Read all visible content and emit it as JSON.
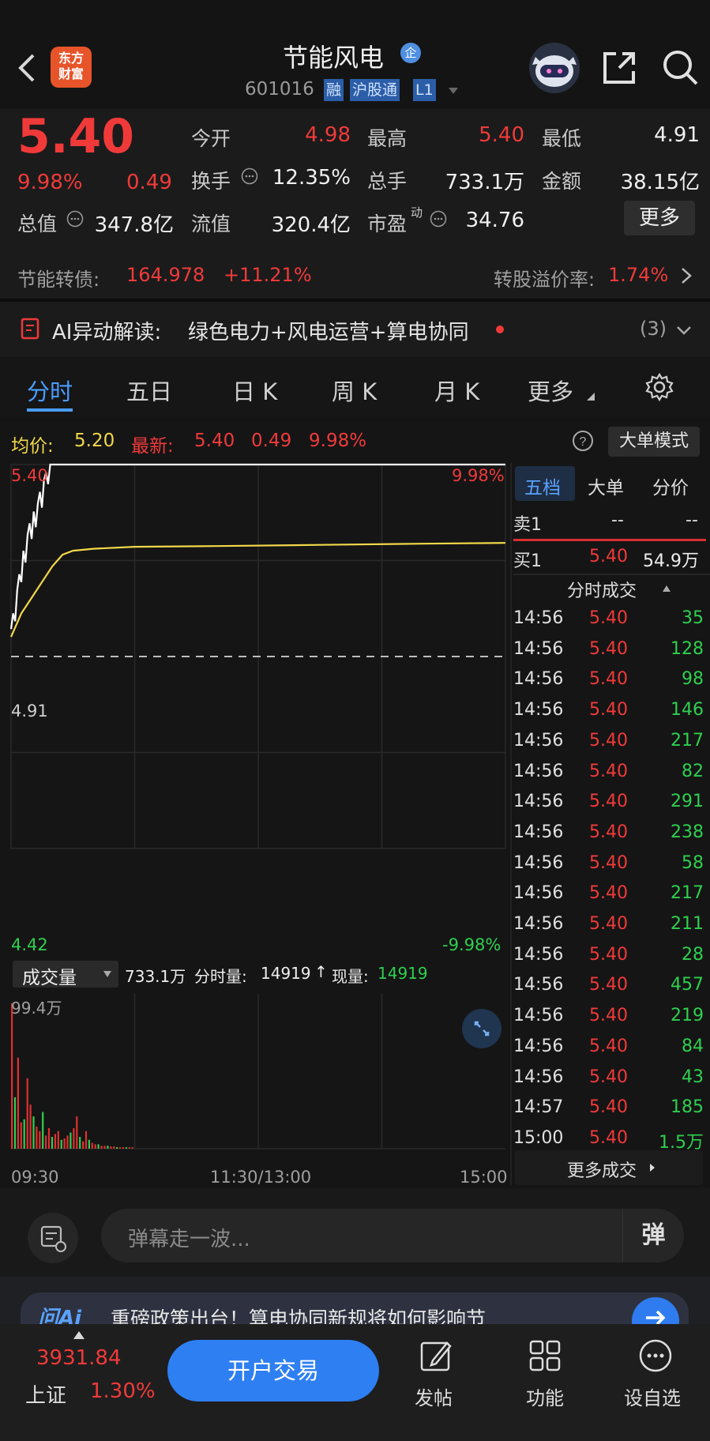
{
  "header": {
    "back_icon": "chevron-left-icon",
    "logo_line1": "东方",
    "logo_line2": "财富",
    "stock_name": "节能风电",
    "enterprise_badge": "企",
    "stock_code": "601016",
    "tags": [
      "融",
      "沪股通",
      "L1"
    ],
    "assistant_icon": "robot-avatar-icon",
    "share_icon": "share-icon",
    "search_icon": "search-icon"
  },
  "quote": {
    "price": "5.40",
    "change_pct": "9.98%",
    "change": "0.49",
    "today_open_label": "今开",
    "today_open": "4.98",
    "high_label": "最高",
    "high": "5.40",
    "low_label": "最低",
    "low": "4.91",
    "turnover_label": "换手",
    "turnover": "12.35%",
    "volume_label": "总手",
    "volume": "733.1万",
    "amount_label": "金额",
    "amount": "38.15亿",
    "mktcap_label": "总值",
    "mktcap": "347.8亿",
    "float_label": "流值",
    "float_cap": "320.4亿",
    "pe_label": "市盈",
    "pe_sup": "动",
    "pe": "34.76",
    "more_button": "更多"
  },
  "convertible": {
    "label": "节能转债:",
    "price": "164.978",
    "change": "+11.21%",
    "premium_label": "转股溢价率:",
    "premium": "1.74%"
  },
  "ai_bar": {
    "label": "AI异动解读:",
    "text": "绿色电力+风电运营+算电协同",
    "count": "(3)"
  },
  "tabs": [
    "分时",
    "五日",
    "日 K",
    "周 K",
    "月 K",
    "更多"
  ],
  "chart_info": {
    "avg_label": "均价:",
    "avg": "5.20",
    "latest_label": "最新:",
    "latest": "5.40",
    "latest_change": "0.49",
    "latest_pct": "9.98%",
    "big_order_mode": "大单模式"
  },
  "chart_data": {
    "type": "line",
    "x_ticks": [
      "09:30",
      "11:30/13:00",
      "15:00"
    ],
    "y_left_ticks": [
      "5.40",
      "4.91",
      "4.42"
    ],
    "y_right_ticks": [
      "9.98%",
      "-9.98%"
    ],
    "ylim": [
      4.42,
      5.4
    ],
    "prev_close": 4.91,
    "series": [
      {
        "name": "price",
        "color": "#ffffff",
        "x": [
          0,
          1,
          2,
          3,
          4,
          5,
          6,
          7,
          8,
          9,
          10,
          11,
          12,
          13,
          14,
          15,
          16,
          17,
          18,
          19,
          20,
          240
        ],
        "values": [
          4.98,
          5.02,
          5.0,
          5.08,
          5.12,
          5.1,
          5.18,
          5.15,
          5.22,
          5.25,
          5.21,
          5.28,
          5.24,
          5.3,
          5.33,
          5.29,
          5.36,
          5.38,
          5.35,
          5.4,
          5.4,
          5.4
        ]
      },
      {
        "name": "avg",
        "color": "#f2d84a",
        "x": [
          0,
          5,
          10,
          15,
          20,
          25,
          30,
          40,
          60,
          100,
          150,
          200,
          240
        ],
        "values": [
          4.96,
          5.02,
          5.06,
          5.1,
          5.14,
          5.17,
          5.18,
          5.185,
          5.19,
          5.192,
          5.195,
          5.198,
          5.2
        ]
      }
    ],
    "volume": {
      "label": "成交量",
      "total": "733.1万",
      "minute_label": "分时量:",
      "minute": "14919",
      "current_label": "现量:",
      "current": "14919",
      "max_tick": "99.4万",
      "bars": [
        99,
        35,
        62,
        18,
        20,
        48,
        30,
        22,
        15,
        12,
        25,
        9,
        14,
        8,
        10,
        12,
        6,
        7,
        9,
        11,
        14,
        22,
        8,
        5,
        12,
        6,
        4,
        3,
        3,
        2,
        2,
        2,
        1.5,
        1.5,
        1,
        1,
        1,
        1,
        1,
        1
      ]
    }
  },
  "orderbook": {
    "tabs": [
      "五档",
      "大单",
      "分价"
    ],
    "sell1_label": "卖1",
    "sell1_price": "--",
    "sell1_vol": "--",
    "buy1_label": "买1",
    "buy1_price": "5.40",
    "buy1_vol": "54.9万",
    "ticks_header": "分时成交",
    "ticks": [
      {
        "time": "14:56",
        "price": "5.40",
        "vol": "35"
      },
      {
        "time": "14:56",
        "price": "5.40",
        "vol": "128"
      },
      {
        "time": "14:56",
        "price": "5.40",
        "vol": "98"
      },
      {
        "time": "14:56",
        "price": "5.40",
        "vol": "146"
      },
      {
        "time": "14:56",
        "price": "5.40",
        "vol": "217"
      },
      {
        "time": "14:56",
        "price": "5.40",
        "vol": "82"
      },
      {
        "time": "14:56",
        "price": "5.40",
        "vol": "291"
      },
      {
        "time": "14:56",
        "price": "5.40",
        "vol": "238"
      },
      {
        "time": "14:56",
        "price": "5.40",
        "vol": "58"
      },
      {
        "time": "14:56",
        "price": "5.40",
        "vol": "217"
      },
      {
        "time": "14:56",
        "price": "5.40",
        "vol": "211"
      },
      {
        "time": "14:56",
        "price": "5.40",
        "vol": "28"
      },
      {
        "time": "14:56",
        "price": "5.40",
        "vol": "457"
      },
      {
        "time": "14:56",
        "price": "5.40",
        "vol": "219"
      },
      {
        "time": "14:56",
        "price": "5.40",
        "vol": "84"
      },
      {
        "time": "14:56",
        "price": "5.40",
        "vol": "43"
      },
      {
        "time": "14:57",
        "price": "5.40",
        "vol": "185"
      },
      {
        "time": "15:00",
        "price": "5.40",
        "vol": "1.5万"
      }
    ],
    "more_trades": "更多成交"
  },
  "comment": {
    "placeholder": "弹幕走一波...",
    "danmu_button": "弹"
  },
  "promo": {
    "brand": "问Ai",
    "text": "重磅政策出台！算电协同新规将如何影响节"
  },
  "bottom_nav": {
    "index_value": "3931.84",
    "index_name": "上证",
    "index_change": "1.30%",
    "trade_button": "开户交易",
    "items": [
      "发帖",
      "功能",
      "设自选"
    ]
  }
}
